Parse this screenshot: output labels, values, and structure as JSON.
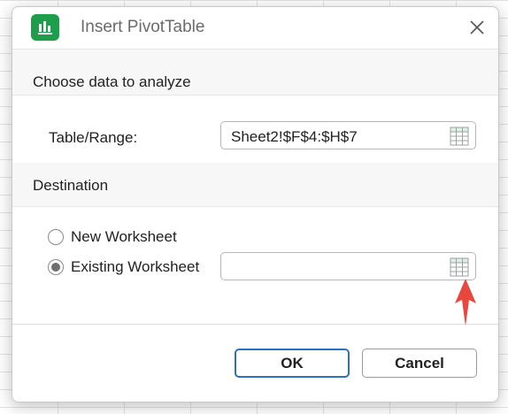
{
  "dialog": {
    "title": "Insert PivotTable",
    "section_data": "Choose data to analyze",
    "table_range_label": "Table/Range:",
    "table_range_value": "Sheet2!$F$4:$H$7",
    "section_destination": "Destination",
    "radio_new": "New Worksheet",
    "radio_existing": "Existing Worksheet",
    "selected_destination": "Existing Worksheet",
    "existing_location_value": "",
    "ok_label": "OK",
    "cancel_label": "Cancel"
  },
  "colors": {
    "app_icon": "#1e9e4a",
    "ok_border": "#2f6fbf",
    "annotation_arrow": "#e8473e"
  },
  "icons": [
    "pivot-table-app-icon",
    "close-icon",
    "range-selector-icon",
    "annotation-arrow"
  ]
}
